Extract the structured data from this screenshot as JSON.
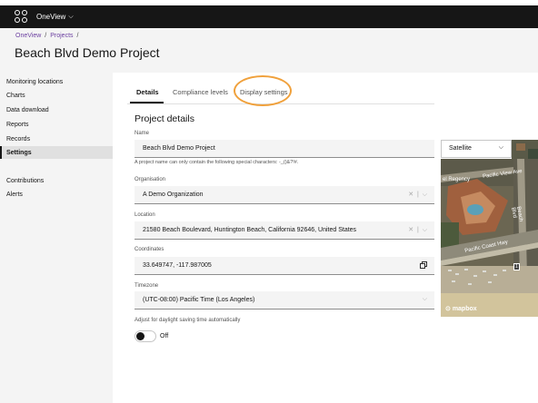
{
  "app": {
    "name": "OneView",
    "menu_chevron": "⌵"
  },
  "breadcrumb": {
    "items": [
      "OneView",
      "Projects"
    ],
    "separator": "/"
  },
  "page_title": "Beach Blvd Demo Project",
  "sidebar": {
    "items": [
      "Monitoring locations",
      "Charts",
      "Data download",
      "Reports",
      "Records",
      "Settings",
      "Contributions",
      "Alerts"
    ],
    "active": "Settings"
  },
  "tabs": [
    "Details",
    "Compliance levels",
    "Display settings"
  ],
  "active_tab": "Details",
  "annotation_color": "#f0a13c",
  "form": {
    "section_title": "Project details",
    "name_label": "Name",
    "name_value": "Beach Blvd Demo Project",
    "name_helper": "A project name can only contain the following special characters: -_()&?!#.",
    "organisation_label": "Organisation",
    "organisation_value": "A Demo Organization",
    "location_label": "Location",
    "location_value": "21580 Beach Boulevard, Huntington Beach, California 92646, United States",
    "coordinates_label": "Coordinates",
    "coordinates_value": "33.649747, -117.987005",
    "timezone_label": "Timezone",
    "timezone_value": "(UTC-08:00) Pacific Time (Los Angeles)",
    "dst_label": "Adjust for daylight saving time automatically",
    "dst_state": "Off",
    "clear_icon": "✕",
    "dropdown_icon": "⌵"
  },
  "map": {
    "layer_select": "Satellite",
    "labels": [
      "Pacific View Ave",
      "Pacific Coast Hwy",
      "Beach Blvd",
      "el Regency"
    ],
    "route_badge": "1",
    "attribution": "mapbox"
  }
}
